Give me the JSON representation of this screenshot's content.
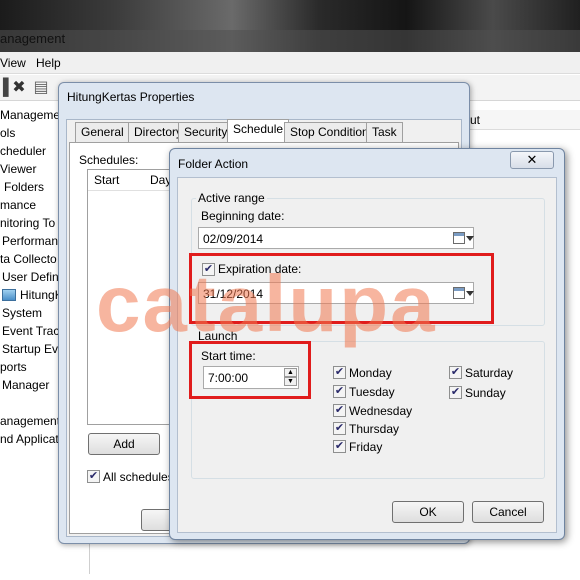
{
  "main_window": {
    "title": "anagement",
    "menu": [
      "View",
      "Help"
    ]
  },
  "tree": {
    "items": [
      "Management",
      "ols",
      "cheduler",
      "Viewer",
      "Folders",
      "mance",
      "nitoring To",
      "Performan",
      "ta Collecto",
      "User Defin",
      "HitungK",
      "System",
      "Event Trac",
      "Startup Ev",
      "ports",
      "Manager",
      "anagement",
      "nd Applicati"
    ]
  },
  "list_header": "ut",
  "properties": {
    "title": "HitungKertas Properties",
    "tabs": [
      "General",
      "Directory",
      "Security",
      "Schedule",
      "Stop Condition",
      "Task"
    ],
    "active_tab": "Schedule",
    "schedules_label": "Schedules:",
    "columns": [
      "Start",
      "Day"
    ],
    "add_button": "Add",
    "all_schedules_label": "All schedules e"
  },
  "folder_action": {
    "title": "Folder Action",
    "close_glyph": "✕",
    "active_range": {
      "label": "Active range",
      "beginning_label": "Beginning date:",
      "beginning_value": "02/09/2014",
      "expiration_label": "Expiration date:",
      "expiration_value": "31/12/2014",
      "expiration_checked": true
    },
    "launch": {
      "label": "Launch",
      "start_time_label": "Start time:",
      "start_time_value": "7:00:00",
      "days_col1": [
        "Monday",
        "Tuesday",
        "Wednesday",
        "Thursday",
        "Friday"
      ],
      "days_col2": [
        "Saturday",
        "Sunday"
      ]
    },
    "ok_button": "OK",
    "cancel_button": "Cancel"
  },
  "watermark": "catalupa",
  "colors": {
    "highlight_red": "#e01c1c",
    "dialog_frame": "#dde6f1",
    "watermark": "#f07850"
  }
}
